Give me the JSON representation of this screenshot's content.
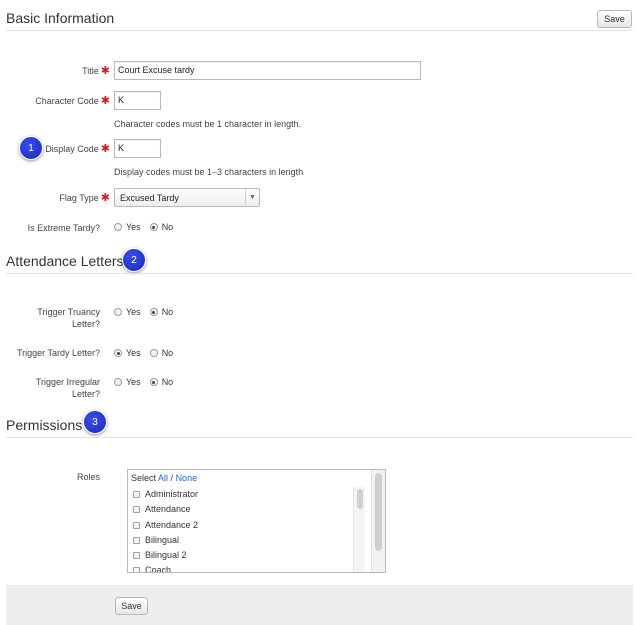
{
  "basic": {
    "title": "Basic Information",
    "save_label": "Save",
    "title_label": "Title",
    "title_value": "Court Excuse tardy",
    "char_code_label": "Character Code",
    "char_code_value": "K",
    "char_code_hint": "Character codes must be 1 character in length.",
    "display_code_label": "Display Code",
    "display_code_value": "K",
    "display_code_hint": "Display codes must be 1–3 characters in length",
    "flag_type_label": "Flag Type",
    "flag_type_value": "Excused Tardy",
    "extreme_label": "Is Extreme Tardy?",
    "yes": "Yes",
    "no": "No",
    "required_mark": "✱"
  },
  "letters": {
    "title": "Attendance Letters",
    "truancy_label_1": "Trigger Truancy",
    "truancy_label_2": "Letter?",
    "tardy_label": "Trigger Tardy Letter?",
    "irregular_label_1": "Trigger Irregular",
    "irregular_label_2": "Letter?",
    "yes": "Yes",
    "no": "No"
  },
  "permissions": {
    "title": "Permissions",
    "roles_label": "Roles",
    "select_prefix": "Select ",
    "select_all": "All",
    "select_sep": " / ",
    "select_none": "None",
    "roles": [
      "Administrator",
      "Attendance",
      "Attendance 2",
      "Bilingual",
      "Bilingual 2",
      "Coach"
    ]
  },
  "footer": {
    "save_label": "Save"
  },
  "badges": [
    "1",
    "2",
    "3"
  ],
  "selected": {
    "extreme_tardy": "No",
    "trigger_truancy": "No",
    "trigger_tardy": "Yes",
    "trigger_irregular": "No"
  },
  "colors": {
    "badge": "#1f2fd0",
    "required": "#cc2222",
    "link": "#2a66b8"
  }
}
